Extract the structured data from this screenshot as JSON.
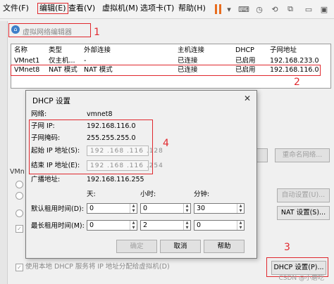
{
  "menubar": {
    "items": [
      "文件(F)",
      "编辑(E)",
      "查看(V)",
      "虚拟机(M)",
      "选项卡(T)",
      "帮助(H)"
    ],
    "accent": "#e86d1f"
  },
  "editor": {
    "title": "虚拟网络编辑器",
    "columns": [
      "名称",
      "类型",
      "外部连接",
      "主机连接",
      "DHCP",
      "子网地址"
    ],
    "rows": [
      {
        "name": "VMnet1",
        "type": "仅主机...",
        "external": "-",
        "host": "已连接",
        "dhcp": "已启用",
        "subnet": "192.168.233.0"
      },
      {
        "name": "VMnet8",
        "type": "NAT 模式",
        "external": "NAT 模式",
        "host": "已连接",
        "dhcp": "已启用",
        "subnet": "192.168.116.0"
      }
    ],
    "rename_button": "重命名网络...",
    "auto_settings_button": "自动设置(U)...",
    "nat_settings_button": "NAT 设置(S)...",
    "dhcp_settings_button": "DHCP 设置(P)...",
    "dhcp_checkbox_label": "使用本地 DHCP 服务将 IP 地址分配给虚拟机(D)",
    "vmnet_label": "VMn"
  },
  "dhcp_dialog": {
    "title": "DHCP 设置",
    "network_label": "网络:",
    "network_value": "vmnet8",
    "subnet_ip_label": "子网 IP:",
    "subnet_ip_value": "192.168.116.0",
    "subnet_mask_label": "子网掩码:",
    "subnet_mask_value": "255.255.255.0",
    "start_ip_label": "起始 IP 地址(S):",
    "start_ip_value": "192 .168 .116 .128",
    "end_ip_label": "结束 IP 地址(E):",
    "end_ip_value": "192 .168 .116 .254",
    "broadcast_label": "广播地址:",
    "broadcast_value": "192.168.116.255",
    "col_days": "天:",
    "col_hours": "小时:",
    "col_minutes": "分钟:",
    "default_lease_label": "默认租用时间(D):",
    "default_lease": [
      "0",
      "0",
      "30"
    ],
    "max_lease_label": "最长租用时间(M):",
    "max_lease": [
      "0",
      "2",
      "0"
    ],
    "ok_button": "确定",
    "cancel_button": "取消",
    "help_button": "帮助"
  },
  "annotations": [
    "1",
    "2",
    "3",
    "4"
  ],
  "annotation_color": "#e0282e",
  "watermark": "CSDN @小蘑吃"
}
